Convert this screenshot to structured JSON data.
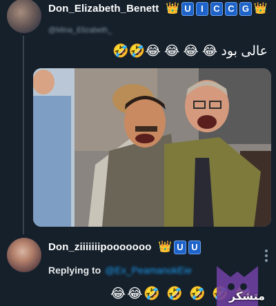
{
  "tweet": {
    "username": "Don_Elizabeth_Benett",
    "badges": [
      "U",
      "I",
      "C",
      "C",
      "G"
    ],
    "handle": "@Mina_Elizabeth_",
    "text": "عالی بود 😂 😂 😂 😂🤣🤣"
  },
  "reply": {
    "username": "Don_ziiiiiiipooooooo",
    "badges": [
      "U",
      "U"
    ],
    "replying_to_label": "Replying to",
    "replying_to_handle": "@Ex_PeamanokEie",
    "text": "😂😂🤣 🤣 🤣 🤣 🤣"
  },
  "watermark": {
    "text": "متشکر"
  },
  "icons": [
    "crown-icon",
    "more-options-icon",
    "watermark-logo-icon"
  ],
  "colors": {
    "background": "#15202b",
    "badge": "#1e63c9",
    "crown": "#f5b800",
    "link": "#1d9bf0",
    "muted": "#8899a6"
  }
}
